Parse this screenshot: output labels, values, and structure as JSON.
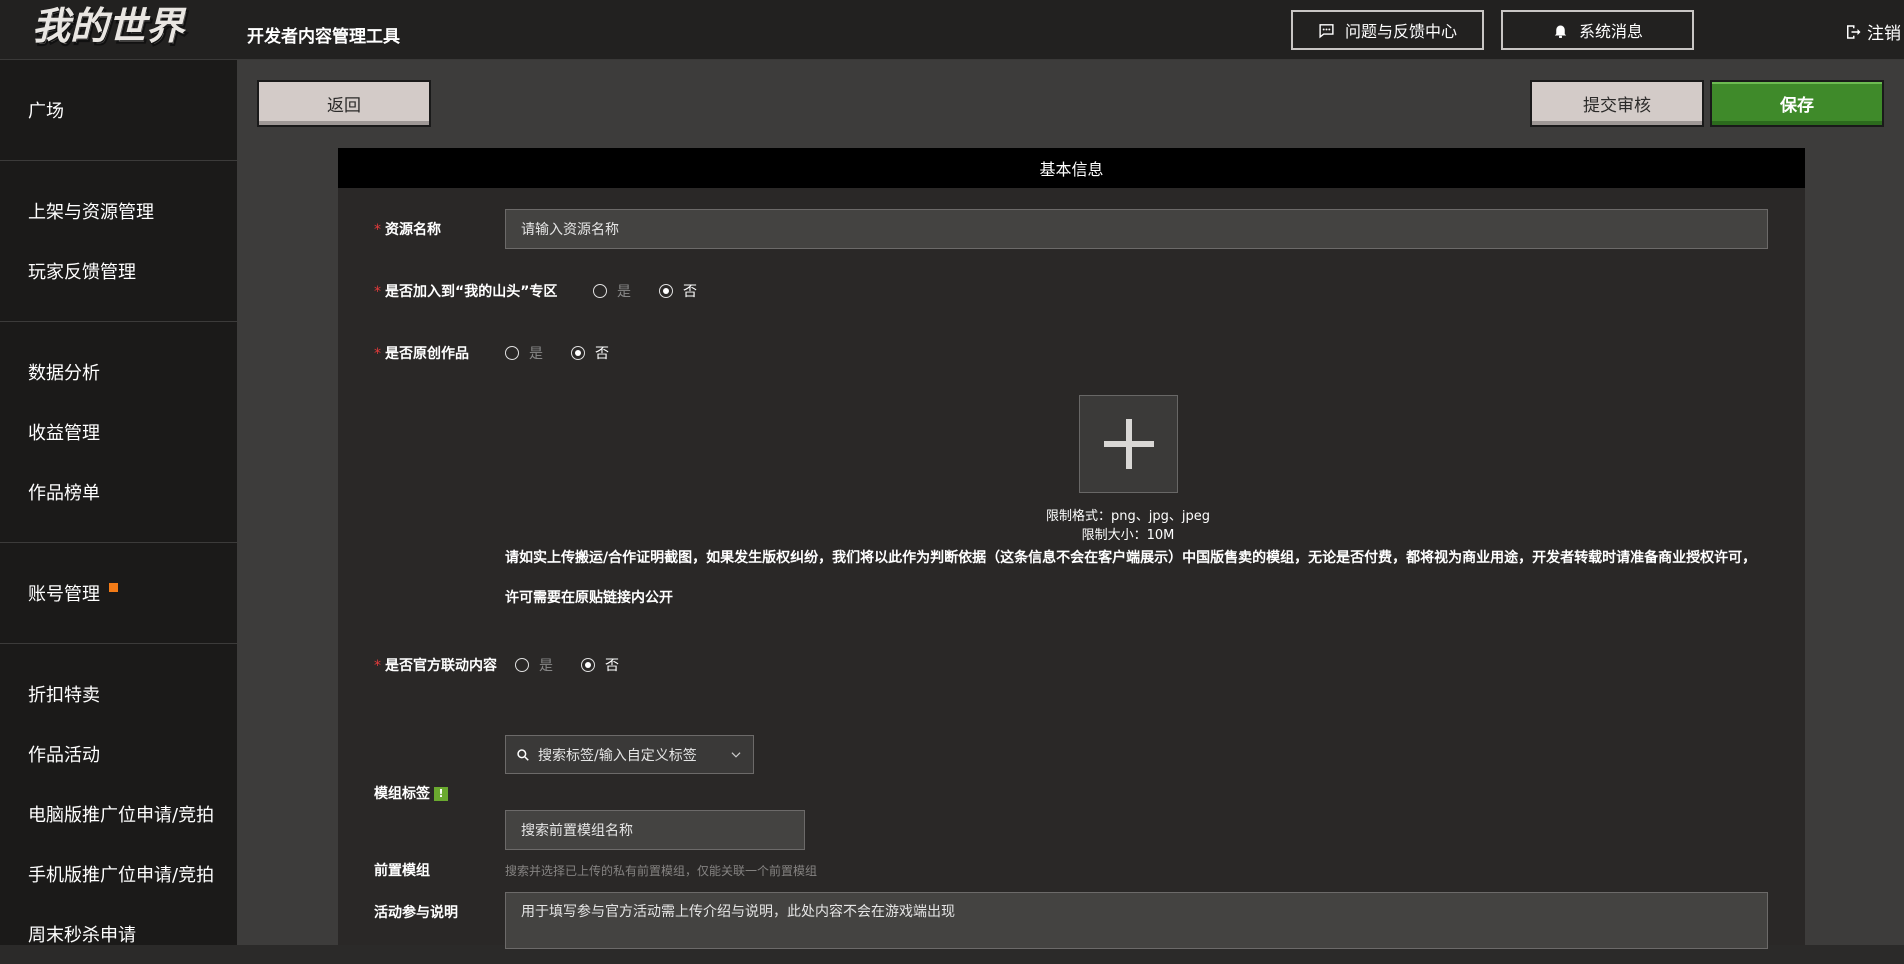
{
  "header": {
    "logo_text": "我的世界",
    "app_title": "开发者内容管理工具",
    "feedback_label": "问题与反馈中心",
    "messages_label": "系统消息",
    "logout_label": "注销"
  },
  "sidebar": {
    "groups": [
      [
        "广场"
      ],
      [
        "上架与资源管理",
        "玩家反馈管理"
      ],
      [
        "数据分析",
        "收益管理",
        "作品榜单"
      ],
      [
        "账号管理"
      ],
      [
        "折扣特卖",
        "作品活动",
        "电脑版推广位申请/竞拍",
        "手机版推广位申请/竞拍",
        "周末秒杀申请"
      ]
    ]
  },
  "toolbar": {
    "back_label": "返回",
    "submit_label": "提交审核",
    "save_label": "保存"
  },
  "form": {
    "section_title": "基本信息",
    "required_mark": "*",
    "resource_name": {
      "label": "资源名称",
      "placeholder": "请输入资源名称"
    },
    "join_zone": {
      "label": "是否加入到“我的山头”专区",
      "yes": "是",
      "no": "否",
      "selected": "no"
    },
    "original": {
      "label": "是否原创作品",
      "yes": "是",
      "no": "否",
      "selected": "no"
    },
    "upload": {
      "format_hint": "限制格式：png、jpg、jpeg",
      "size_hint": "限制大小：10M"
    },
    "notice_line1": "请如实上传搬运/合作证明截图，如果发生版权纠纷，我们将以此作为判断依据（这条信息不会在客户端展示）中国版售卖的模组，无论是否付费，都将视为商业用途，开发者转载时请准备商业授权许可，",
    "notice_line2": "许可需要在原贴链接内公开",
    "official_collab": {
      "label": "是否官方联动内容",
      "yes": "是",
      "no": "否",
      "selected": "no"
    },
    "tags": {
      "label": "模组标签",
      "info_mark": "!",
      "placeholder": "搜索标签/输入自定义标签"
    },
    "prerequisite": {
      "label": "前置模组",
      "placeholder": "搜索前置模组名称",
      "help": "搜索并选择已上传的私有前置模组，仅能关联一个前置模组"
    },
    "activity": {
      "label": "活动参与说明",
      "placeholder": "用于填写参与官方活动需上传介绍与说明，此处内容不会在游戏端出现"
    }
  },
  "colors": {
    "accent_green": "#3f8a2a",
    "required_red": "#e43b3b",
    "badge_orange": "#f27b17"
  }
}
